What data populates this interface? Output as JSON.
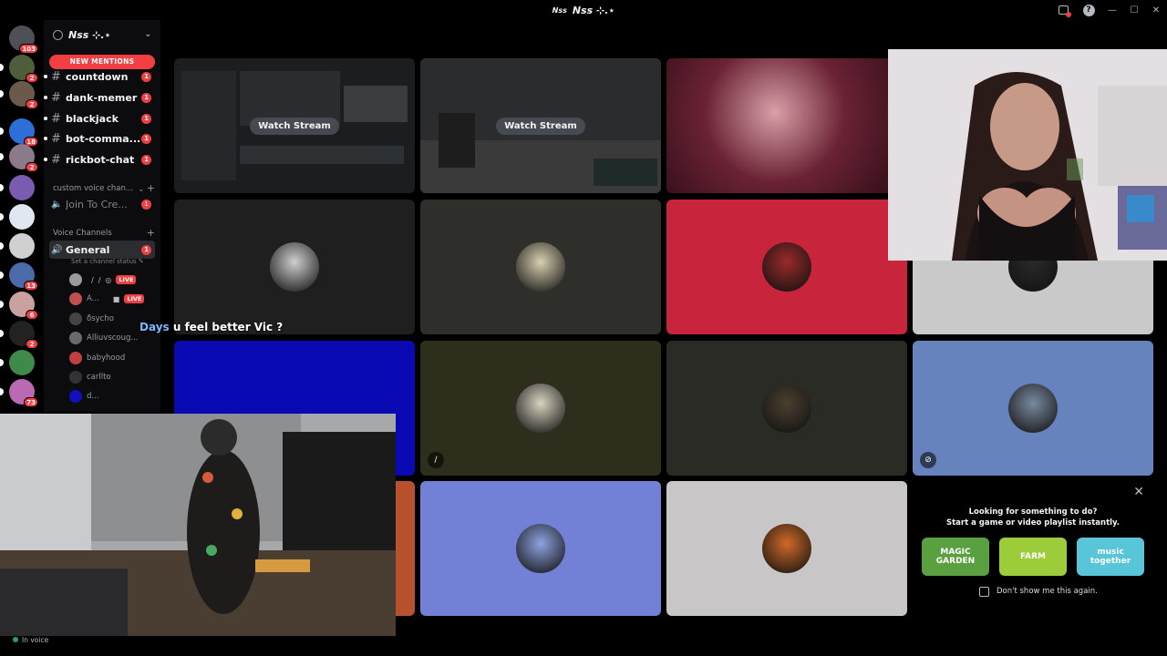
{
  "window": {
    "title": "Nss ⊹.⋆",
    "server_mini": "Nss"
  },
  "server_rail": {
    "items": [
      {
        "name": "direct-messages",
        "badge": "103",
        "color": "#4e5058"
      },
      {
        "name": "server-1",
        "badge": "2",
        "color": "#4d5f3a"
      },
      {
        "name": "server-2",
        "badge": "2",
        "color": "#6b5a4c"
      },
      {
        "name": "server-3",
        "badge": "18",
        "color": "#2d6fd6"
      },
      {
        "name": "server-4",
        "badge": "2",
        "color": "#8b7a8a"
      },
      {
        "name": "server-5",
        "badge": "",
        "color": "#7a5bb0"
      },
      {
        "name": "server-6",
        "badge": "",
        "color": "#dfe8f0"
      },
      {
        "name": "server-7",
        "badge": "",
        "color": "#d0d0d0"
      },
      {
        "name": "server-8",
        "badge": "13",
        "color": "#4a6aa8"
      },
      {
        "name": "server-9",
        "badge": "6",
        "color": "#c9a2a0"
      },
      {
        "name": "server-10",
        "badge": "2",
        "color": "#222222"
      },
      {
        "name": "server-11",
        "badge": "",
        "color": "#3f8a4a"
      },
      {
        "name": "server-12",
        "badge": "73",
        "color": "#b96ab2"
      }
    ]
  },
  "sidebar": {
    "server_name": "Nss ⊹.⋆",
    "new_mentions": "NEW MENTIONS",
    "text_channels": [
      {
        "name": "countdown",
        "count": "1"
      },
      {
        "name": "dank-memer",
        "count": "1"
      },
      {
        "name": "blackjack",
        "count": "1"
      },
      {
        "name": "bot-comma...",
        "count": "1"
      },
      {
        "name": "rickbot-chat",
        "count": "1"
      }
    ],
    "custom_voice_category": "custom voice chan...",
    "join_to_create": "Join To Cre...",
    "join_to_create_count": "1",
    "voice_category": "Voice Channels",
    "general_channel": "General",
    "general_count": "1",
    "channel_status": "Set a channel status",
    "voice_users": [
      {
        "name": "",
        "live": "LIVE",
        "color": "#9a9a9a"
      },
      {
        "name": "A...",
        "live": "LIVE",
        "color": "#c05050"
      },
      {
        "name": "ðsycho",
        "live": "",
        "color": "#444444"
      },
      {
        "name": "Alliuvscoug...",
        "live": "",
        "color": "#6a6a6a"
      },
      {
        "name": "babyhood",
        "live": "",
        "color": "#c04040"
      },
      {
        "name": "carllto",
        "live": "",
        "color": "#333333"
      },
      {
        "name": "d...",
        "live": "",
        "color": "#1010c0"
      }
    ]
  },
  "stage": {
    "watch_stream": "Watch Stream",
    "tiles": [
      {
        "bg": "#1f2022",
        "avatar": "#6a6a6a",
        "kind": "stream"
      },
      {
        "bg": "#2a2b2c",
        "avatar": "#5a5a5a",
        "kind": "stream"
      },
      {
        "bg": "#7a2a3a",
        "avatar": "",
        "kind": "camera"
      },
      {
        "bg": "#1e1f1e",
        "avatar": "#cfcfcf",
        "kind": "avatar"
      },
      {
        "bg": "#2e2f2b",
        "avatar": "#d8d0b0",
        "kind": "avatar"
      },
      {
        "bg": "#c8243c",
        "avatar": "#9a2a2a",
        "kind": "avatar"
      },
      {
        "bg": "#c9c9c9",
        "avatar": "#2a2a2a",
        "kind": "avatar"
      },
      {
        "bg": "#0a0ab4",
        "avatar": "",
        "kind": "blank"
      },
      {
        "bg": "#2d2e1c",
        "avatar": "#d8d4c0",
        "kind": "avatar"
      },
      {
        "bg": "#2a2b24",
        "avatar": "#4a4030",
        "kind": "avatar"
      },
      {
        "bg": "#6683bd",
        "avatar": "#7a8aa0",
        "kind": "avatar"
      },
      {
        "bg": "#b8522e",
        "avatar": "",
        "kind": "blank"
      },
      {
        "bg": "#7280d6",
        "avatar": "#8ea2e0",
        "kind": "avatar"
      },
      {
        "bg": "#c9c6c8",
        "avatar": "#d06a28",
        "kind": "avatar"
      }
    ]
  },
  "caption": {
    "highlight": "Days",
    "text": "u feel better Vic ?"
  },
  "activity": {
    "line1": "Looking for something to do?",
    "line2": "Start a game or video playlist instantly.",
    "apps": [
      {
        "label": "MAGIC GARDEN",
        "color": "#5aa040"
      },
      {
        "label": "FARM",
        "color": "#9ccc3a"
      },
      {
        "label": "music together",
        "color": "#58c6d8"
      }
    ],
    "dont_show": "Don't show me this again."
  },
  "user_panel": {
    "status": "In voice"
  }
}
